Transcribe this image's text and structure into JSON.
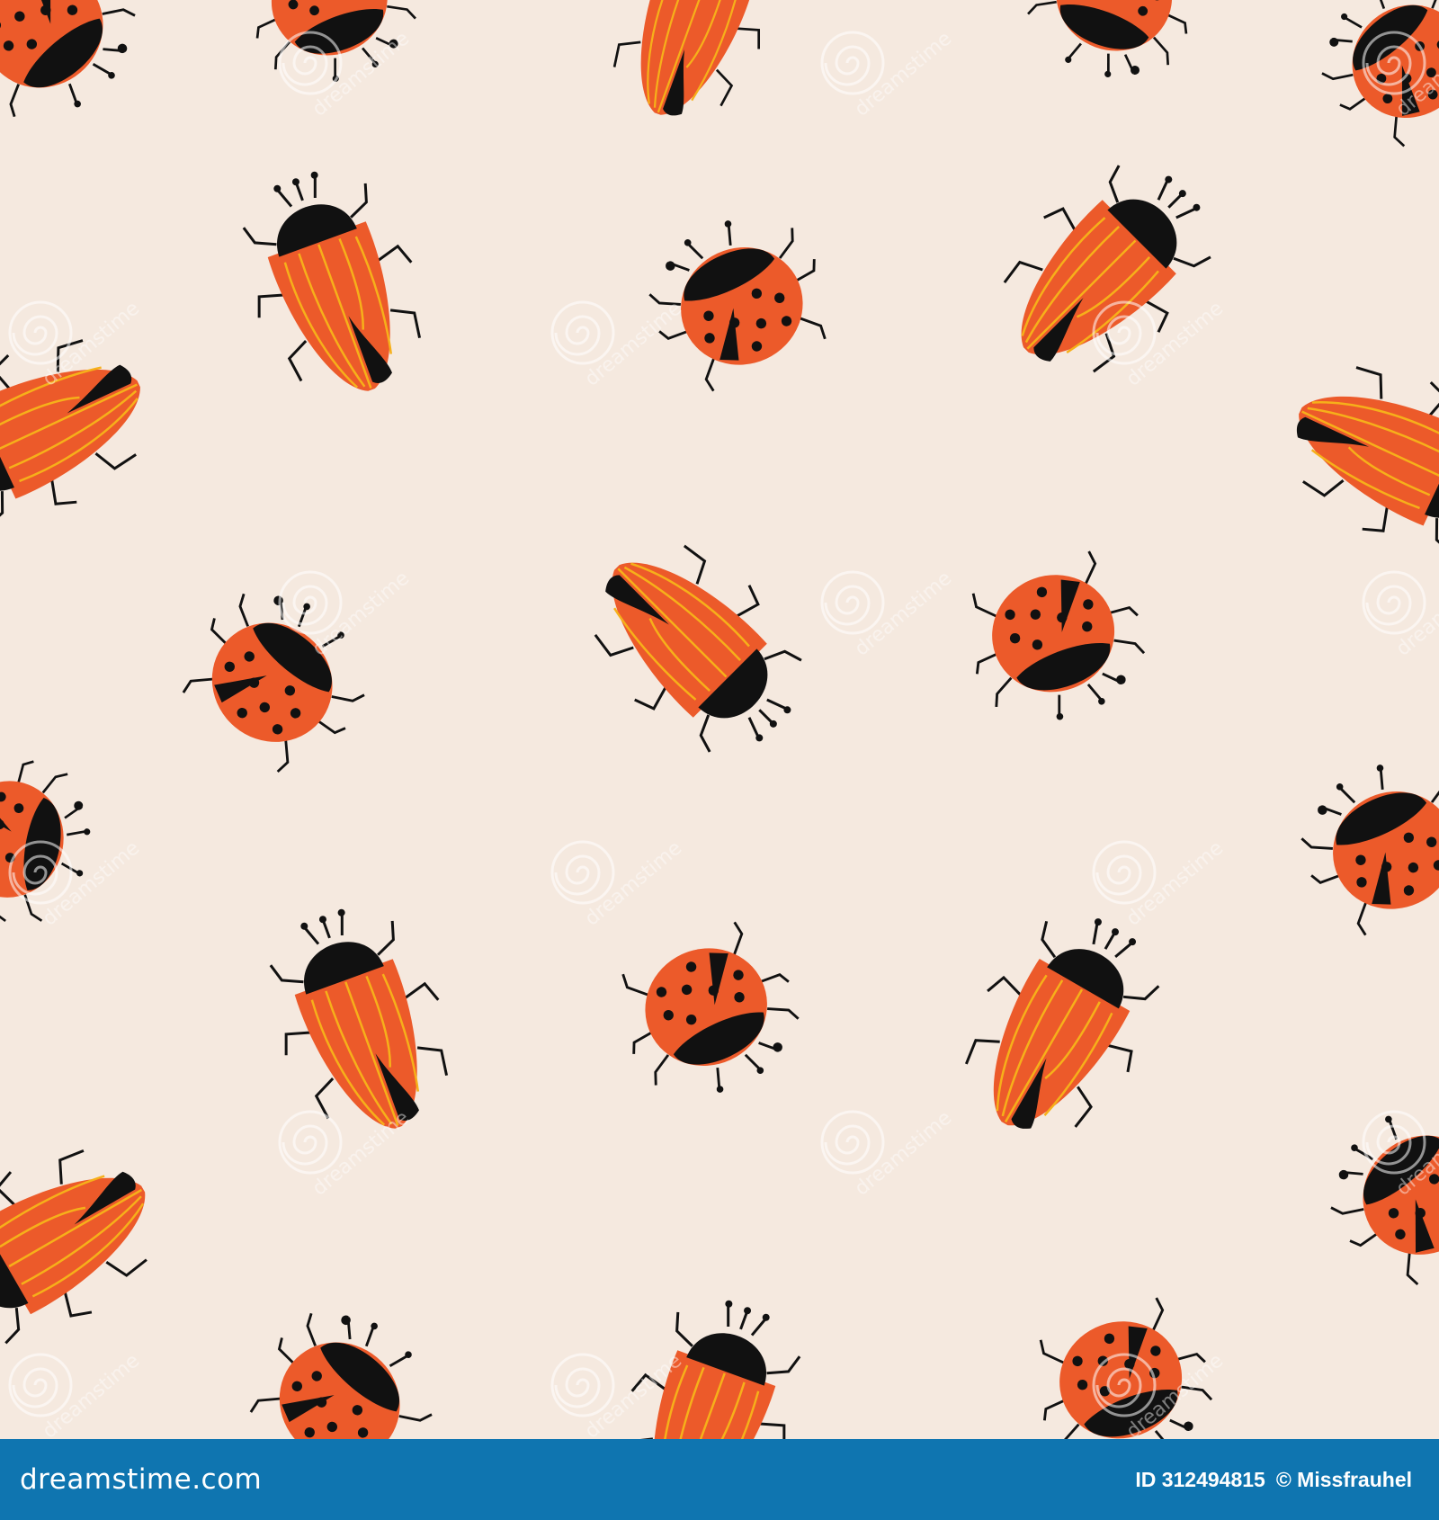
{
  "colors": {
    "background": "#f5e9df",
    "bug_body": "#ec5a2a",
    "bug_black": "#111111",
    "stripe": "#f6b01a",
    "footer": "#0f75b0",
    "watermark": "#ffffff"
  },
  "footer": {
    "brand": "dreamstime.com",
    "id_text": "ID 312494815",
    "author": "© Missfrauhel"
  },
  "watermark_text": "dreamstime",
  "icon_names": [
    "ladybug-icon",
    "striped-beetle-icon",
    "dreamstime-spiral-logo-icon"
  ]
}
